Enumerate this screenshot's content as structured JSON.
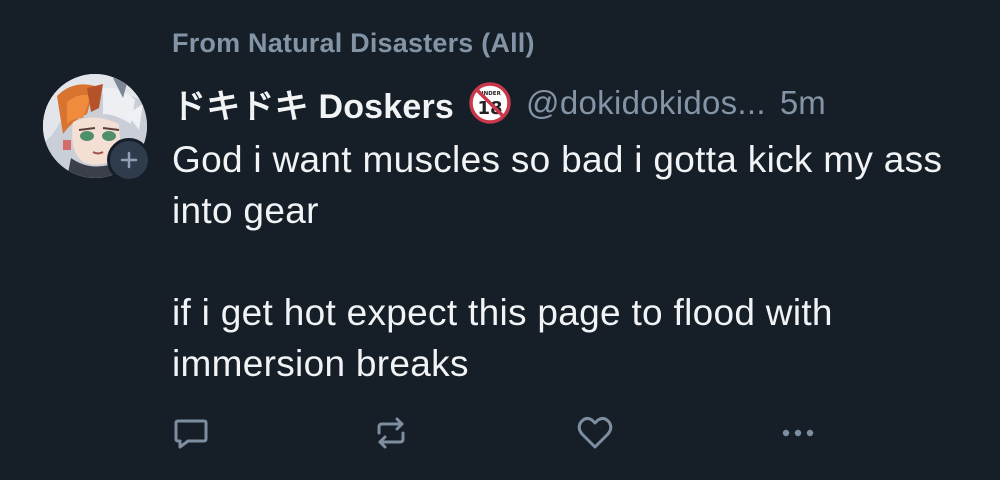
{
  "feed_context": "From Natural Disasters (All)",
  "author": {
    "display_name": "ドキドキ Doskers",
    "handle": "@dokidokidos...",
    "label_badge": "UNDER 18"
  },
  "timestamp": "5m",
  "post": {
    "lines": [
      "God i want muscles so bad i gotta kick my ass into gear",
      "if i get hot expect this page to flood with immersion breaks"
    ]
  },
  "actions": {
    "reply_icon": "speech-bubble",
    "repost_icon": "repeat-arrows",
    "like_icon": "heart",
    "more_icon": "ellipsis"
  },
  "colors": {
    "background": "#161e27",
    "primary_text": "#f1f3f5",
    "secondary_text": "#8394a6",
    "icon": "#7d8ea1"
  }
}
